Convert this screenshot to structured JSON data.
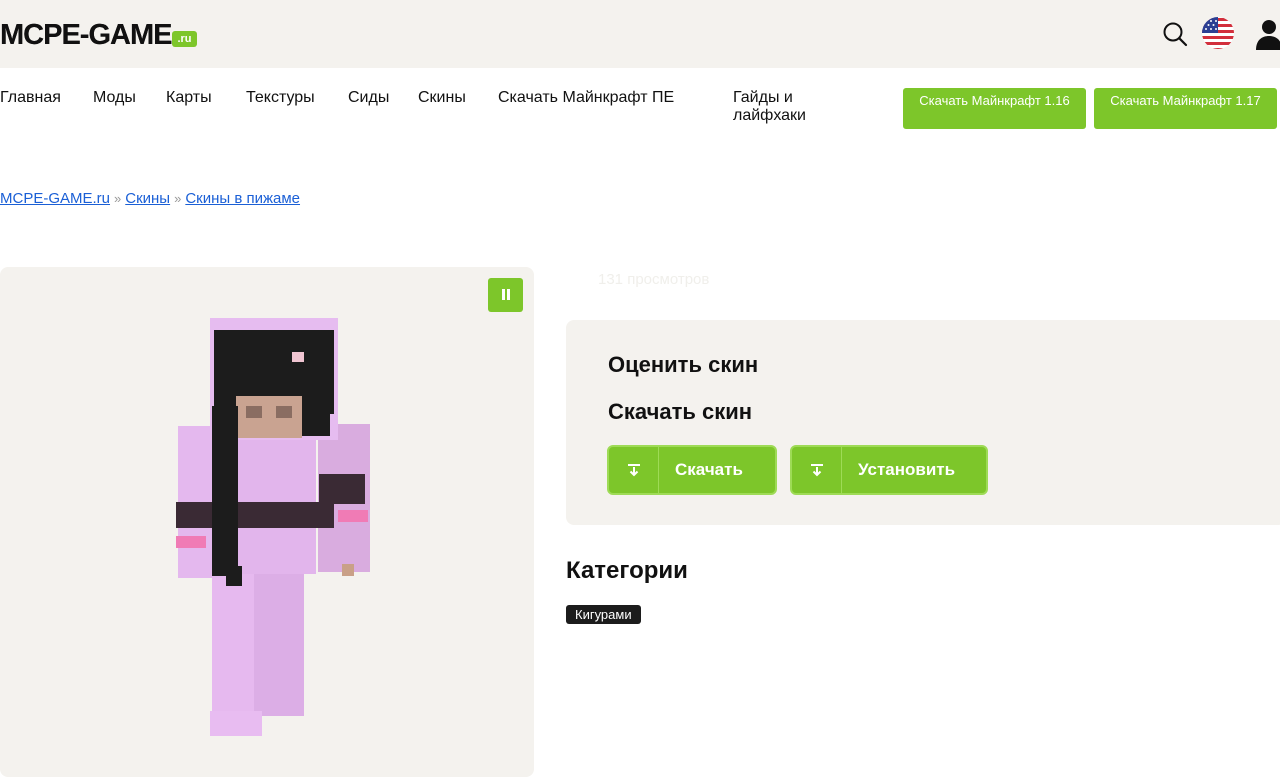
{
  "header": {
    "logo_text": "MCPE-GAME",
    "logo_suffix": ".ru",
    "icons": [
      "search-icon",
      "us-flag-icon",
      "user-icon"
    ]
  },
  "nav": {
    "items": [
      {
        "label": "Главная"
      },
      {
        "label": "Моды"
      },
      {
        "label": "Карты"
      },
      {
        "label": "Текстуры"
      },
      {
        "label": "Сиды"
      },
      {
        "label": "Скины"
      },
      {
        "label": "Скачать Майнкрафт ПЕ"
      },
      {
        "label": "Гайды и лайфхаки"
      }
    ],
    "download_buttons": [
      {
        "label": "Скачать Майнкрафт 1.16"
      },
      {
        "label": "Скачать Майнкрафт 1.17"
      }
    ]
  },
  "breadcrumb": {
    "items": [
      "MCPE-GAME.ru",
      "Скины",
      "Скины в пижаме"
    ],
    "separator": "»"
  },
  "skin": {
    "views": "131 просмотров"
  },
  "panel": {
    "rate_heading": "Оценить скин",
    "download_heading": "Скачать скин",
    "download_button": "Скачать",
    "install_button": "Установить"
  },
  "categories": {
    "heading": "Категории",
    "tags": [
      "Кигурами"
    ]
  },
  "colors": {
    "accent": "#7dc62a",
    "link": "#1a5fd6",
    "panel_bg": "#f4f2ee",
    "tag_bg": "#1c1c1c"
  }
}
